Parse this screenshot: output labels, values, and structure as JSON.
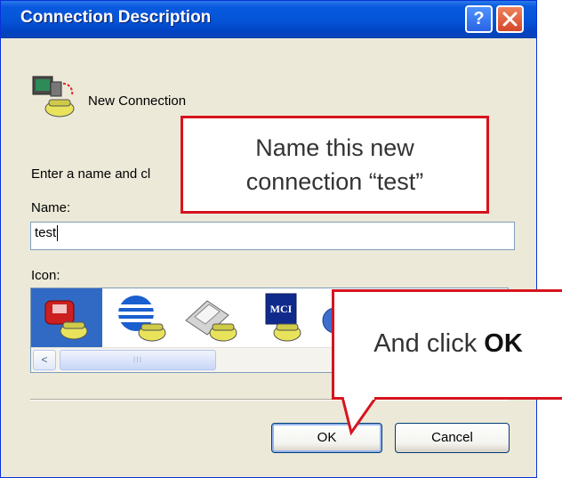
{
  "window": {
    "title": "Connection Description",
    "help_button": "?",
    "close_button": "✕"
  },
  "connection": {
    "label": "New Connection",
    "icon": "telephone-computer-icon"
  },
  "form": {
    "prompt": "Enter a name and cl",
    "name_label": "Name:",
    "name_value": "test",
    "icon_label": "Icon:"
  },
  "icons": [
    {
      "name": "red-phone-icon",
      "selected": true
    },
    {
      "name": "globe-phone-icon",
      "selected": false
    },
    {
      "name": "fax-phone-icon",
      "selected": false
    },
    {
      "name": "mci-phone-icon",
      "selected": false
    },
    {
      "name": "partial-globe-icon",
      "selected": false
    }
  ],
  "scrollbar": {
    "left_arrow": "<",
    "thumb_grip": "III"
  },
  "buttons": {
    "ok": "OK",
    "cancel": "Cancel"
  },
  "annotations": {
    "callout_1_line1": "Name this new",
    "callout_1_line2": "connection “test”",
    "callout_2_prefix": "And click ",
    "callout_2_bold": "OK"
  },
  "colors": {
    "titlebar": "#0454d7",
    "dialog_bg": "#ece9d8",
    "selection": "#316ac5",
    "callout_border": "#d7141e"
  }
}
